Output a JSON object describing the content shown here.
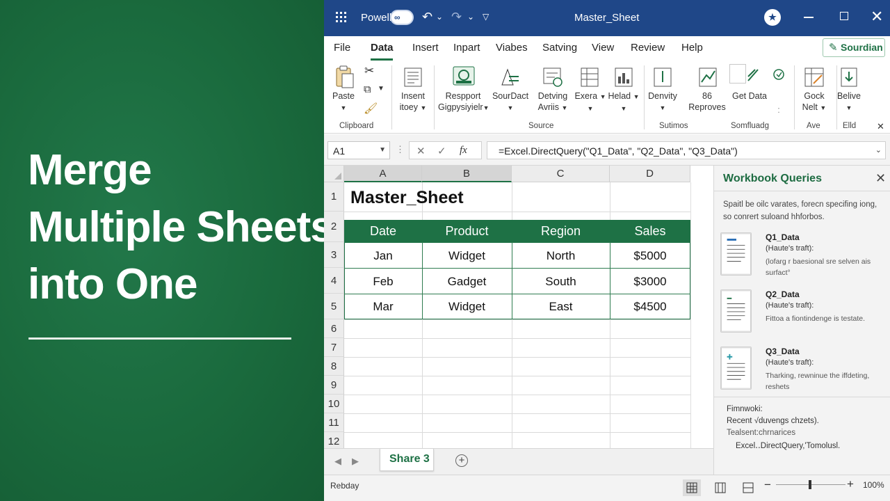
{
  "promo": {
    "title_lines": [
      "Merge",
      "Multiple Sheets",
      "into One"
    ]
  },
  "titlebar": {
    "user": "Powell",
    "toggle_label": "∞",
    "doc_title": "Master_Sheet",
    "avatar_letter": "★"
  },
  "tabs": [
    "File",
    "Data",
    "Insert",
    "Inpart",
    "Viabes",
    "Satving",
    "View",
    "Review",
    "Help"
  ],
  "active_tab": "Data",
  "share_button": "Sourdian",
  "ribbon": {
    "paste": "Paste",
    "insert": [
      "Insent",
      "itoey"
    ],
    "respport": [
      "Respport",
      "Gigpysiyielr"
    ],
    "sourdact": "SourDact",
    "detving": [
      "Detving",
      "Avriis"
    ],
    "exera": "Exera",
    "heiad": "Helad",
    "denvity": "Denvity",
    "reproves": "86 Reproves",
    "get_data": "Get Data",
    "gock": [
      "Gock",
      "Nelt"
    ],
    "belive": "Belive",
    "groups": {
      "clipboard": "Clipboard",
      "source": "Source",
      "sutimos": "Sutimos",
      "somfluadg": "Somfluadg",
      "ave": "Ave",
      "elld": "Elld"
    }
  },
  "formula_bar": {
    "name_box": "A1",
    "formula": "=Excel.DirectQuery(\"Q1_Data\", \"Q2_Data\", \"Q3_Data\")",
    "fx_label": "fx"
  },
  "grid": {
    "columns": [
      "A",
      "B",
      "C",
      "D"
    ],
    "rows": [
      "1",
      "2",
      "3",
      "4",
      "5",
      "6",
      "7",
      "8",
      "9",
      "10",
      "11",
      "12"
    ],
    "sheet_title": "Master_Sheet",
    "headers": [
      "Date",
      "Product",
      "Region",
      "Sales"
    ],
    "data": [
      [
        "Jan",
        "Widget",
        "North",
        "$5000"
      ],
      [
        "Feb",
        "Gadget",
        "South",
        "$3000"
      ],
      [
        "Mar",
        "Widget",
        "East",
        "$4500"
      ]
    ]
  },
  "sheet_tabs": {
    "active": "Share 3"
  },
  "queries_pane": {
    "title": "Workbook Queries",
    "description": "Spaitl be oilc varates, forecn specifing iong, so conrert suloand hhforbos.",
    "queries": [
      {
        "name": "Q1_Data",
        "sub": "(Haute's traft):",
        "desc": "(lofarg r baesional sre selven ais surfact°"
      },
      {
        "name": "Q2_Data",
        "sub": "(Haute's traft):",
        "desc": "Fittoa a fiontindenge is testate."
      },
      {
        "name": "Q3_Data",
        "sub": "(Haute's traft):",
        "desc": "Tharking, rewninue the iffdeting, reshets"
      }
    ],
    "footer_title": "Fimnwoki:",
    "footer_line1": "Recent √duvengs chzets).",
    "footer_line2": "Tealsent:chrnarices",
    "footer_line3": "Excel‥DirectQuery,'Tomolusl."
  },
  "status": {
    "left_text": "Rebday",
    "zoom": "100%"
  },
  "colors": {
    "excel_green": "#1e7145",
    "titlebar_blue": "#1f4788",
    "promo_green": "#1b6b3e"
  }
}
